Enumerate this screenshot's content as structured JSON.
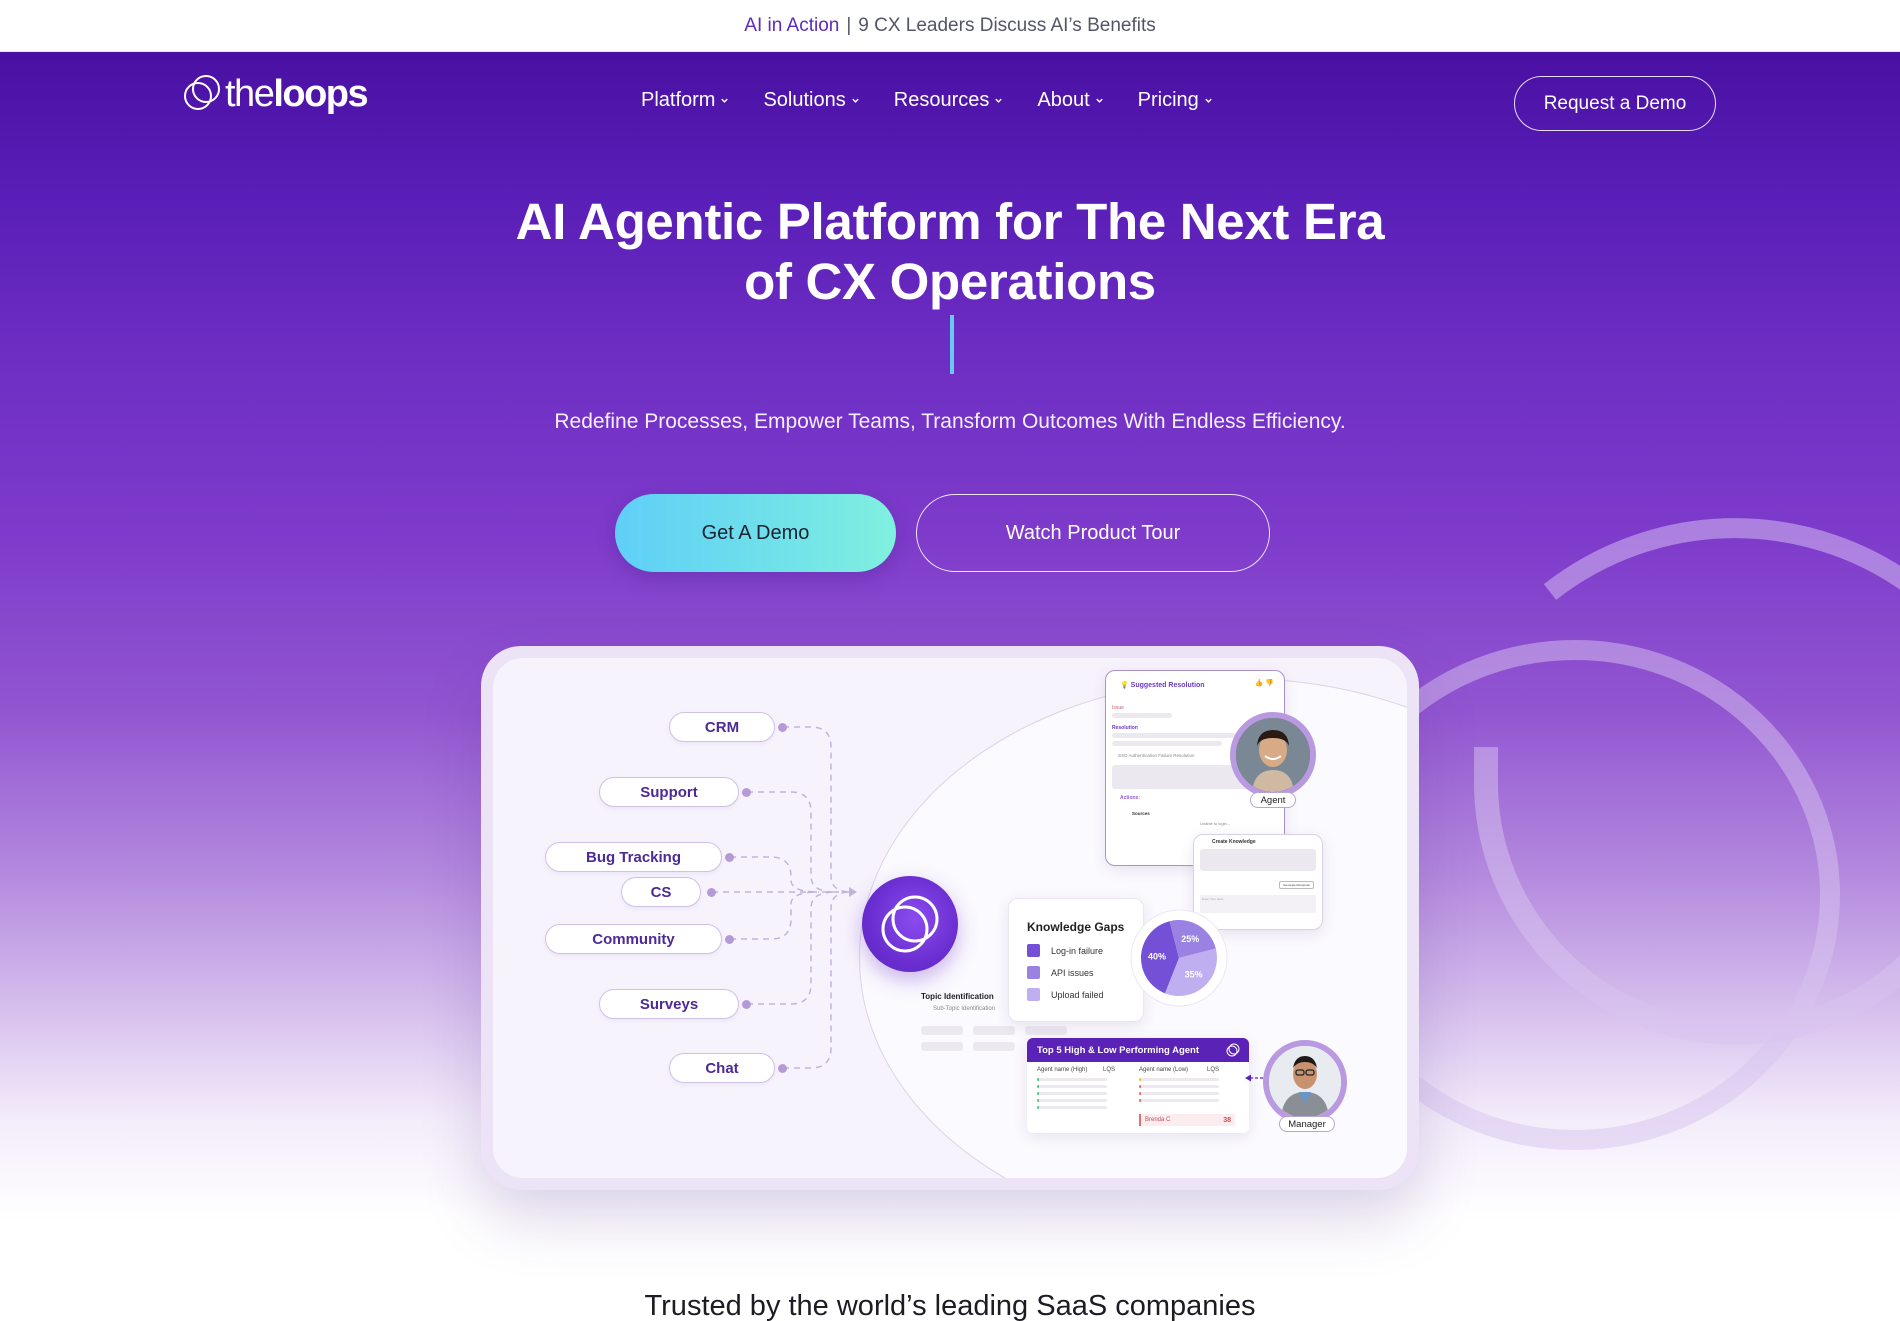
{
  "banner": {
    "accent_text": "AI in Action",
    "separator": "|",
    "text": "9 CX Leaders Discuss AI’s Benefits"
  },
  "nav": {
    "logo_light": "the",
    "logo_bold": "loops",
    "menu": [
      {
        "label": "Platform"
      },
      {
        "label": "Solutions"
      },
      {
        "label": "Resources"
      },
      {
        "label": "About"
      },
      {
        "label": "Pricing"
      }
    ],
    "cta_label": "Request a Demo"
  },
  "hero": {
    "headline_line1": "AI Agentic Platform for The Next Era",
    "headline_line2": "of CX Operations",
    "subtitle": "Redefine Processes, Empower Teams, Transform Outcomes With Endless Efficiency.",
    "primary_cta": "Get A Demo",
    "secondary_cta": "Watch Product Tour"
  },
  "dashboard": {
    "sources": [
      "CRM",
      "Support",
      "Bug Tracking",
      "CS",
      "Community",
      "Surveys",
      "Chat"
    ],
    "topic_title": "Topic Identification",
    "topic_sub": "Sub-Topic Identification",
    "suggested_resolution": {
      "title": "Suggested Resolution",
      "issue_label": "Issue",
      "resolution_label": "Resolution",
      "bullet": "SSO Authentication Failure Resolution",
      "actions_label": "Actions:",
      "sources_label": "Sources",
      "source_item": "Unable to login..."
    },
    "create_knowledge": {
      "title": "Create Knowledge",
      "button": "Generate Response",
      "placeholder": "Enter Your Here"
    },
    "knowledge_gaps": {
      "title": "Knowledge Gaps",
      "items": [
        {
          "label": "Log-in failure",
          "percent": 40,
          "color": "#7350d6"
        },
        {
          "label": "API issues",
          "percent": 25,
          "color": "#9a82e3"
        },
        {
          "label": "Upload failed",
          "percent": 35,
          "color": "#bfaef0"
        }
      ]
    },
    "performance": {
      "title": "Top 5 High & Low Performing Agent",
      "col_high": "Agent name (High)",
      "col_lqs": "LQS",
      "col_low": "Agent name (Low)",
      "highlight_name": "Brenda C",
      "highlight_score": "38"
    },
    "agent_label": "Agent",
    "manager_label": "Manager"
  },
  "trusted": {
    "title": "Trusted by the world’s leading SaaS companies"
  },
  "colors": {
    "brand_purple": "#4a10a3",
    "accent_cyan": "#5fcff7",
    "accent_mint": "#80f0df",
    "banner_accent": "#5b2bc0"
  }
}
